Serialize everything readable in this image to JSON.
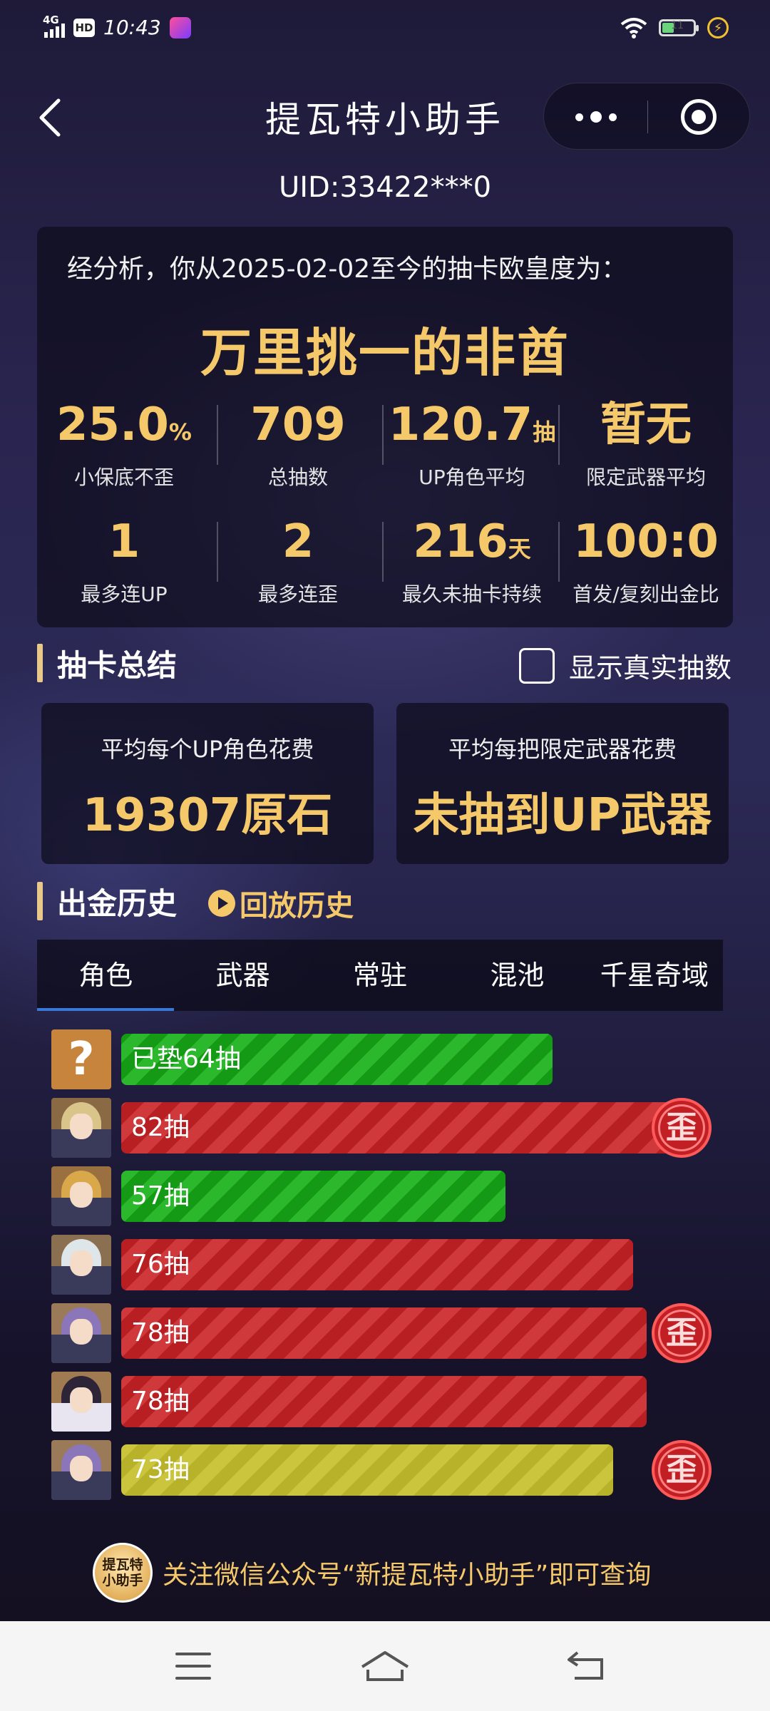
{
  "status_bar": {
    "network": "4G",
    "hd": "HD",
    "time": "10:43",
    "battery_level": "11"
  },
  "header": {
    "title": "提瓦特小助手",
    "uid": "UID:33422***0"
  },
  "analysis": {
    "intro": "经分析，你从2025-02-02至今的抽卡欧皇度为：",
    "verdict": "万里挑一的非酋",
    "stats": [
      {
        "value": "25.0",
        "unit": "%",
        "label": "小保底不歪"
      },
      {
        "value": "709",
        "unit": "",
        "label": "总抽数"
      },
      {
        "value": "120.7",
        "unit": "抽",
        "label": "UP角色平均"
      },
      {
        "value": "暂无",
        "unit": "",
        "label": "限定武器平均"
      },
      {
        "value": "1",
        "unit": "",
        "label": "最多连UP"
      },
      {
        "value": "2",
        "unit": "",
        "label": "最多连歪"
      },
      {
        "value": "216",
        "unit": "天",
        "label": "最久未抽卡持续"
      },
      {
        "value": "100:0",
        "unit": "",
        "label": "首发/复刻出金比"
      }
    ]
  },
  "summary": {
    "title": "抽卡总结",
    "show_real_label": "显示真实抽数",
    "cards": [
      {
        "label": "平均每个UP角色花费",
        "value": "19307原石"
      },
      {
        "label": "平均每把限定武器花费",
        "value": "未抽到UP武器"
      }
    ]
  },
  "history": {
    "title": "出金历史",
    "replay_label": "回放历史",
    "tabs": [
      "角色",
      "武器",
      "常驻",
      "混池",
      "千星奇域"
    ],
    "active_tab": 0,
    "wai_label": "歪",
    "unknown_avatar": "?",
    "rows": [
      {
        "label": "已垫64抽",
        "pulls": 64,
        "color": "green",
        "wai": false,
        "avatar": "unknown"
      },
      {
        "label": "82抽",
        "pulls": 82,
        "color": "red",
        "wai": true,
        "avatar": "blonde"
      },
      {
        "label": "57抽",
        "pulls": 57,
        "color": "green",
        "wai": false,
        "avatar": "golden"
      },
      {
        "label": "76抽",
        "pulls": 76,
        "color": "red",
        "wai": false,
        "avatar": "white"
      },
      {
        "label": "78抽",
        "pulls": 78,
        "color": "red",
        "wai": true,
        "avatar": "purple"
      },
      {
        "label": "78抽",
        "pulls": 78,
        "color": "red",
        "wai": false,
        "avatar": "dark"
      },
      {
        "label": "73抽",
        "pulls": 73,
        "color": "yellow",
        "wai": true,
        "avatar": "purple"
      }
    ]
  },
  "footer": {
    "logo_text": "提瓦特小助手",
    "text": "关注微信公众号“新提瓦特小助手”即可查询"
  },
  "colors": {
    "accent_gold": "#f5c86a",
    "bar_green": "#1fa51f",
    "bar_red": "#c02a2d",
    "bar_yellow": "#c2bb33",
    "tab_underline": "#3a78d8"
  }
}
